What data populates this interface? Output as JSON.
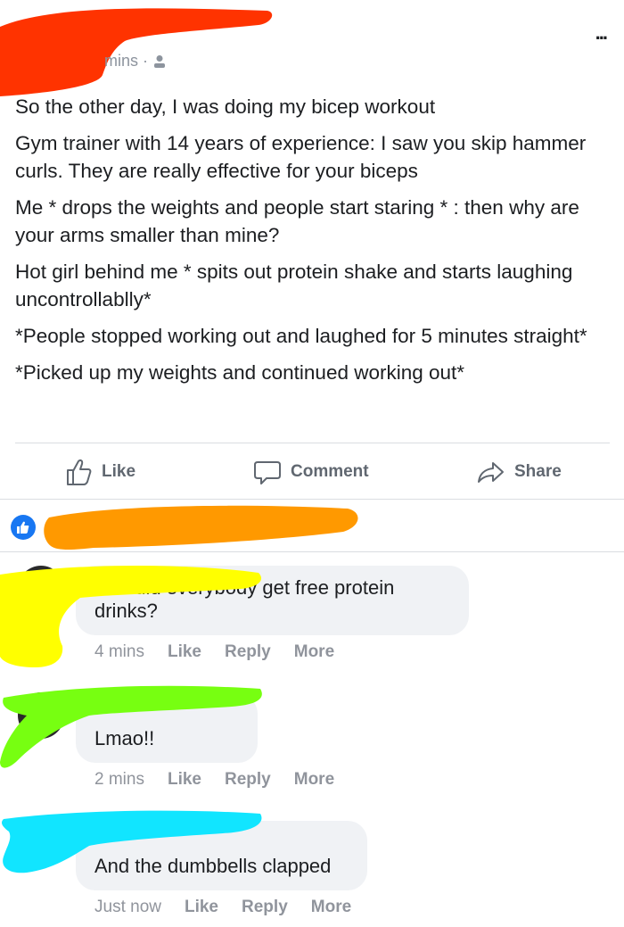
{
  "post": {
    "meta_time": "mins ·",
    "paragraphs": [
      "So the other day, I was doing my bicep workout",
      "Gym trainer with 14 years of experience: I saw you skip hammer curls. They are really effective for your biceps",
      "Me * drops the weights and people start staring * : then why are your arms smaller than mine?",
      "Hot girl behind me * spits out protein shake and starts laughing uncontrollablly*",
      "*People stopped working out and laughed for 5 minutes straight*",
      "*Picked up my weights and continued working out*"
    ],
    "more_options": "..."
  },
  "actions": {
    "like": "Like",
    "comment": "Comment",
    "share": "Share"
  },
  "comments": [
    {
      "text": "And did everybody get free protein drinks?",
      "time": "4 mins",
      "like": "Like",
      "reply": "Reply",
      "more": "More"
    },
    {
      "text": "Lmao!!",
      "time": "2 mins",
      "like": "Like",
      "reply": "Reply",
      "more": "More"
    },
    {
      "text": "And the dumbbells clapped",
      "time": "Just now",
      "like": "Like",
      "reply": "Reply",
      "more": "More"
    }
  ],
  "colors": {
    "redaction_red": "#ff3300",
    "redaction_orange": "#ff9900",
    "redaction_yellow": "#ffff00",
    "redaction_green": "#77ff11",
    "redaction_cyan": "#11e5ff",
    "brand_blue": "#1877f2"
  }
}
